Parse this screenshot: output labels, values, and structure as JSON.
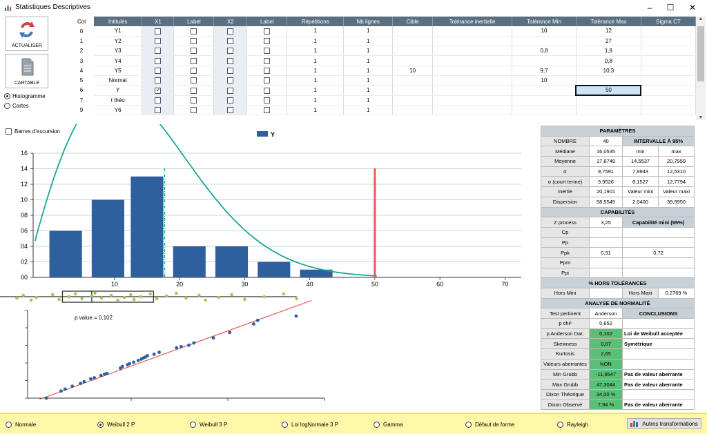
{
  "window": {
    "title": "Statistiques Descriptives"
  },
  "toolbar": {
    "refresh_label": "ACTUALISER",
    "cartable_label": "CARTABLE"
  },
  "view_mode": {
    "options": [
      "Histogramme",
      "Cartes"
    ],
    "selected": "Histogramme"
  },
  "grid": {
    "headers": [
      "Col",
      "Intitulés",
      "X1",
      "Label",
      "X2",
      "Label",
      "Répétitions",
      "Nb lignes",
      "Cible",
      "Tolérance inertielle",
      "Tolérance Min",
      "Tolérance Max",
      "Sigma CT"
    ],
    "rows": [
      {
        "col": "0",
        "name": "Y1",
        "x1": false,
        "rep": "1",
        "nb": "1",
        "cible": "",
        "tinert": "",
        "tmin": "10",
        "tmax": "12"
      },
      {
        "col": "1",
        "name": "Y2",
        "x1": false,
        "rep": "1",
        "nb": "1",
        "cible": "",
        "tinert": "",
        "tmin": "",
        "tmax": "27"
      },
      {
        "col": "2",
        "name": "Y3",
        "x1": false,
        "rep": "1",
        "nb": "1",
        "cible": "",
        "tinert": "",
        "tmin": "0,8",
        "tmax": "1,8"
      },
      {
        "col": "3",
        "name": "Y4",
        "x1": false,
        "rep": "1",
        "nb": "1",
        "cible": "",
        "tinert": "",
        "tmin": "",
        "tmax": "0,8"
      },
      {
        "col": "4",
        "name": "Y5",
        "x1": false,
        "rep": "1",
        "nb": "1",
        "cible": "10",
        "tinert": "",
        "tmin": "9,7",
        "tmax": "10,3"
      },
      {
        "col": "5",
        "name": "Normal",
        "x1": false,
        "rep": "1",
        "nb": "1",
        "cible": "",
        "tinert": "",
        "tmin": "10",
        "tmax": ""
      },
      {
        "col": "6",
        "name": "Y",
        "x1": true,
        "rep": "1",
        "nb": "1",
        "cible": "",
        "tinert": "",
        "tmin": "",
        "tmax": "50"
      },
      {
        "col": "7",
        "name": "t théo",
        "x1": false,
        "rep": "1",
        "nb": "1",
        "cible": "",
        "tinert": "",
        "tmin": "",
        "tmax": ""
      },
      {
        "col": "9",
        "name": "Y6",
        "x1": false,
        "rep": "1",
        "nb": "1",
        "cible": "",
        "tinert": "",
        "tmin": "",
        "tmax": ""
      }
    ]
  },
  "excursion": {
    "label": "Barres d'excursion"
  },
  "chart_data": {
    "type": "bar",
    "legend": "Y",
    "legend_color": "#2e5f9e",
    "bar_color": "#2e5f9e",
    "curve_color": "#1aa594",
    "limit_color": "#e8594f",
    "bins": [
      {
        "x0": 0,
        "x1": 5,
        "count": 6
      },
      {
        "x0": 6.5,
        "x1": 11.5,
        "count": 10
      },
      {
        "x0": 12.5,
        "x1": 17.5,
        "count": 13
      },
      {
        "x0": 19,
        "x1": 24,
        "count": 4
      },
      {
        "x0": 25.5,
        "x1": 30.5,
        "count": 4
      },
      {
        "x0": 32,
        "x1": 37,
        "count": 2
      },
      {
        "x0": 38.5,
        "x1": 43.5,
        "count": 1
      }
    ],
    "x_ticks": [
      "10",
      "20",
      "30",
      "40",
      "50",
      "60",
      "70"
    ],
    "y_ticks": [
      "00",
      "02",
      "04",
      "06",
      "08",
      "10",
      "12",
      "14",
      "16"
    ],
    "xlim": [
      -2.5,
      72.5
    ],
    "ylim": [
      0,
      16
    ],
    "mean_line": 17.7,
    "limit_line": 50,
    "boxplot": {
      "min": -8,
      "q1": 2,
      "median": 6.5,
      "q3": 16,
      "max": 38
    },
    "pvalue_label": "p value = 0,102",
    "qq_points": [
      [
        -11.9,
        0
      ],
      [
        -9,
        2.5
      ],
      [
        -8.2,
        3.2
      ],
      [
        -6.8,
        4.2
      ],
      [
        -5.2,
        5.2
      ],
      [
        -4.5,
        5.8
      ],
      [
        -3.2,
        6.8
      ],
      [
        -2.5,
        7.2
      ],
      [
        -1.2,
        8.0
      ],
      [
        -0.5,
        8.5
      ],
      [
        0,
        8.7
      ],
      [
        2.6,
        10.6
      ],
      [
        3.0,
        11.2
      ],
      [
        4.0,
        11.8
      ],
      [
        4.4,
        12.2
      ],
      [
        5.2,
        12.7
      ],
      [
        6.1,
        13.3
      ],
      [
        6.7,
        13.8
      ],
      [
        7.1,
        14.2
      ],
      [
        7.5,
        14.5
      ],
      [
        7.9,
        15.0
      ],
      [
        9.2,
        15.5
      ],
      [
        10.2,
        16.2
      ],
      [
        13.6,
        17.8
      ],
      [
        14.5,
        18.2
      ],
      [
        16.0,
        18.7
      ],
      [
        17.0,
        19.5
      ],
      [
        20.8,
        21.3
      ],
      [
        24.0,
        23.2
      ],
      [
        28.7,
        26.2
      ],
      [
        29.5,
        27.5
      ],
      [
        37.0,
        29.0
      ]
    ],
    "qq_line": [
      [
        -13.2,
        -0.4
      ],
      [
        40,
        34.5
      ]
    ]
  },
  "parameters": {
    "title": "PARAMÈTRES",
    "nombre_label": "NOMBRE",
    "nombre_value": "40",
    "interval_label": "INTERVALLE À 95%",
    "rows": [
      [
        "Médiane",
        "16,0535",
        "min",
        "max"
      ],
      [
        "Moyenne",
        "17,6748",
        "14,5537",
        "20,7959"
      ],
      [
        "σ",
        "9,7591",
        "7,9943",
        "12,5310"
      ],
      [
        "σ (court terme)",
        "9,9526",
        "8,1527",
        "12,7794"
      ],
      [
        "Inertie",
        "20,1901",
        "Valeur mini",
        "Valeur maxi"
      ],
      [
        "Dispersion",
        "58,5545",
        "2,0400",
        "39,9950"
      ]
    ],
    "cap_title": "CAPABILITÉS",
    "cap_header": [
      "Z process",
      "3,25",
      "Capabilité mini (95%)"
    ],
    "cap_rows": [
      [
        "Cp",
        "",
        ""
      ],
      [
        "Pp",
        "",
        ""
      ],
      [
        "Ppk",
        "0,91",
        "0,72"
      ],
      [
        "Ppm",
        "",
        ""
      ],
      [
        "Ppi",
        "",
        ""
      ]
    ],
    "hors_title": "% HORS TOLÉRANCES",
    "hors_row": [
      "Hors Mini",
      "",
      "Hors Maxi",
      "0,2769 %"
    ],
    "norm_title": "ANALYSE DE NORMALITÉ",
    "norm_header": [
      "Test pertinent",
      "Anderson",
      "CONCLUSIONS"
    ],
    "norm_rows": [
      [
        "p chi²",
        "0,652",
        "",
        false
      ],
      [
        "p Anderson Dar.",
        "0,102",
        "Loi de Weibull acceptée",
        true
      ],
      [
        "Skewness",
        "0,67",
        "Symétrique",
        true
      ],
      [
        "Kurtosis",
        "2,65",
        "",
        true
      ],
      [
        "Valeurs aberrantes",
        "NON",
        "",
        true
      ],
      [
        "Min Grubb",
        "-11,9547",
        "Pas de valeur aberrante",
        true
      ],
      [
        "Max Grubb",
        "47,3044",
        "Pas de valeur aberrante",
        true
      ],
      [
        "Dixon Théorique",
        "34,00 %",
        "",
        true
      ],
      [
        "Dixon Observé",
        "7,94 %",
        "Pas de valeur aberrante",
        true
      ]
    ]
  },
  "distribution": {
    "options": [
      "Normale",
      "Weibull 2 P",
      "Weibull 3 P",
      "Loi logNormale 3 P",
      "Gamma",
      "Défaut de forme",
      "Rayleigh"
    ],
    "selected": "Weibull 2 P",
    "other_label": "Autres transformations"
  }
}
